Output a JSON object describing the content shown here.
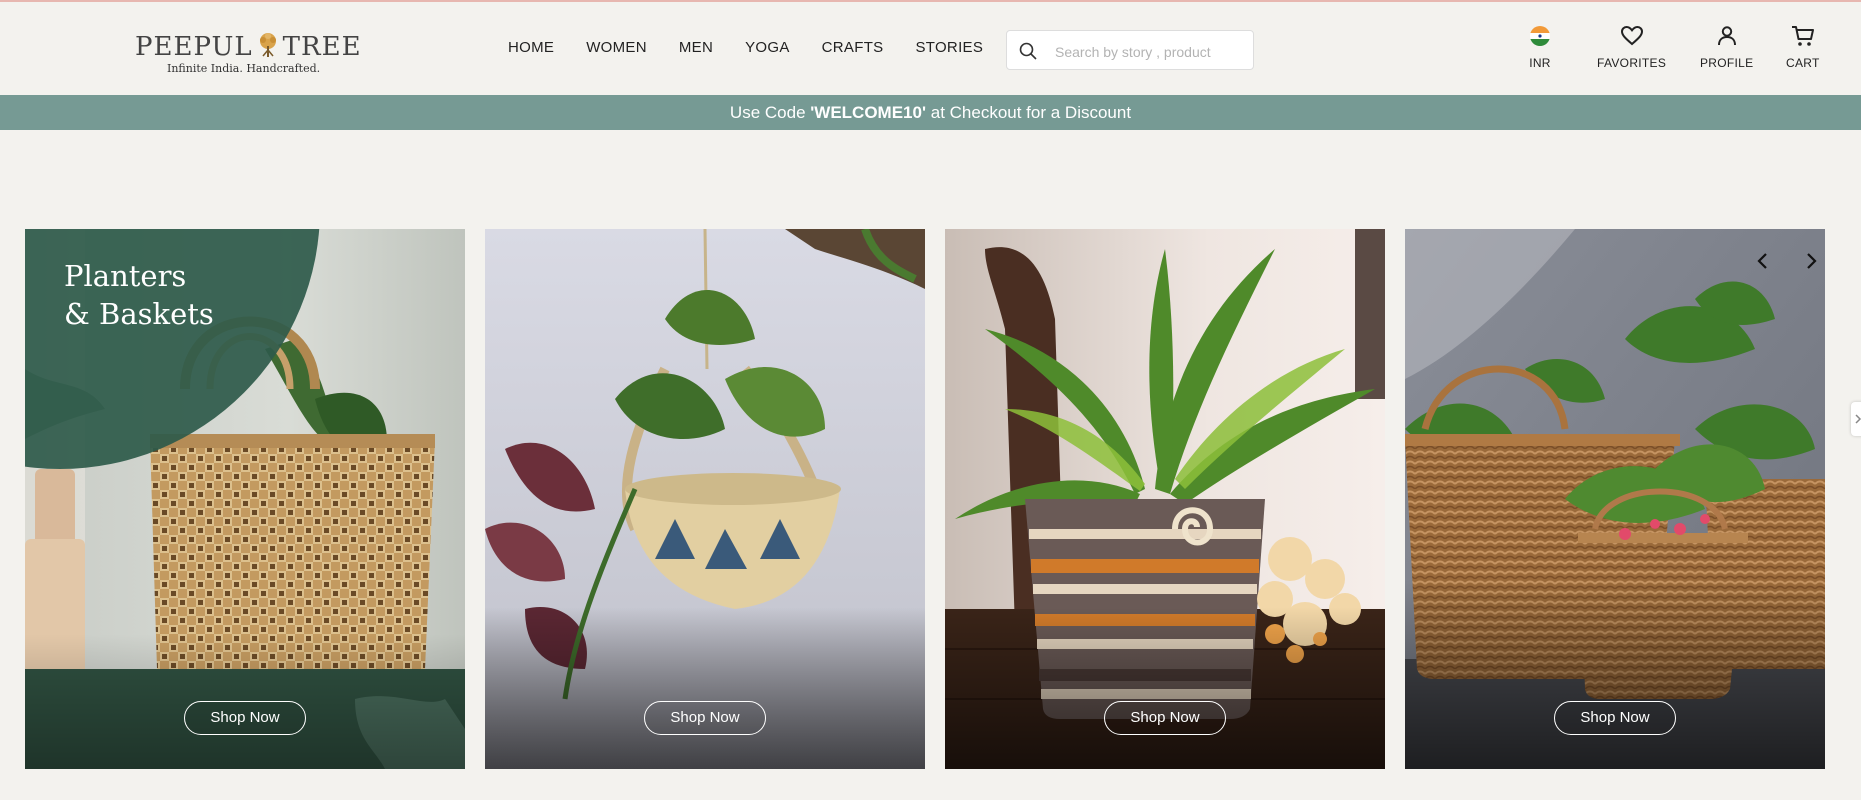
{
  "brand": {
    "name_left": "PEEPUL",
    "name_right": "TREE",
    "tagline": "Infinite India. Handcrafted."
  },
  "nav": [
    {
      "label": "HOME"
    },
    {
      "label": "WOMEN"
    },
    {
      "label": "MEN"
    },
    {
      "label": "YOGA"
    },
    {
      "label": "CRAFTS"
    },
    {
      "label": "STORIES"
    }
  ],
  "search": {
    "placeholder": "Search by story , product",
    "value": ""
  },
  "header_icons": {
    "currency": "INR",
    "favorites": "FAVORITES",
    "profile": "PROFILE",
    "cart": "CART"
  },
  "promo": {
    "prefix": "Use Code ",
    "code": "'WELCOME10'",
    "suffix": " at Checkout for a Discount"
  },
  "carousel": {
    "cards": [
      {
        "title_line1": "Planters",
        "title_line2": "& Baskets",
        "button": "Shop Now"
      },
      {
        "button": "Shop Now"
      },
      {
        "button": "Shop Now"
      },
      {
        "button": "Shop Now"
      }
    ]
  },
  "colors": {
    "background": "#f3f2ee",
    "promo_bar": "#769a94",
    "accent_green": "#2e5a4a"
  }
}
